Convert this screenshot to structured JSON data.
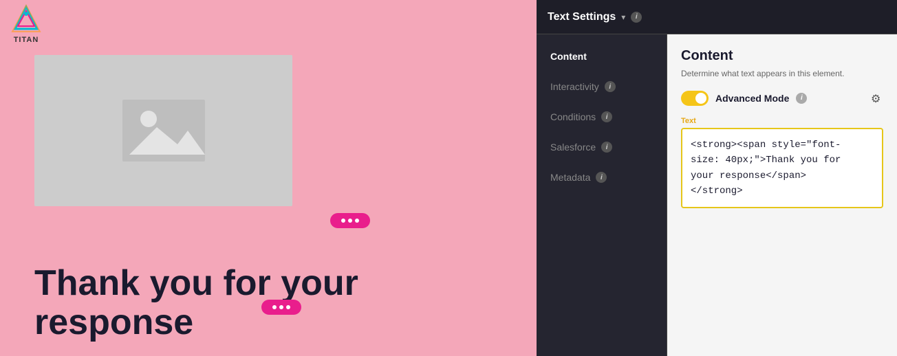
{
  "header": {
    "settings_title": "Text Settings",
    "chevron": "▾",
    "info_label": "i"
  },
  "logo": {
    "text": "TITAN"
  },
  "canvas": {
    "thank_you_line1": "Thank you for your",
    "thank_you_line2": "response"
  },
  "panel_nav": {
    "items": [
      {
        "id": "content",
        "label": "Content",
        "active": true,
        "has_info": false
      },
      {
        "id": "interactivity",
        "label": "Interactivity",
        "active": false,
        "has_info": true
      },
      {
        "id": "conditions",
        "label": "Conditions",
        "active": false,
        "has_info": true
      },
      {
        "id": "salesforce",
        "label": "Salesforce",
        "active": false,
        "has_info": true
      },
      {
        "id": "metadata",
        "label": "Metadata",
        "active": false,
        "has_info": true
      }
    ]
  },
  "panel_content": {
    "title": "Content",
    "description": "Determine what text appears in this element.",
    "advanced_mode_label": "Advanced Mode",
    "info_label": "i",
    "text_label": "Text",
    "text_value": "<strong><span style=\"font-size: 40px;\">Thank you for your response</span></strong>"
  }
}
